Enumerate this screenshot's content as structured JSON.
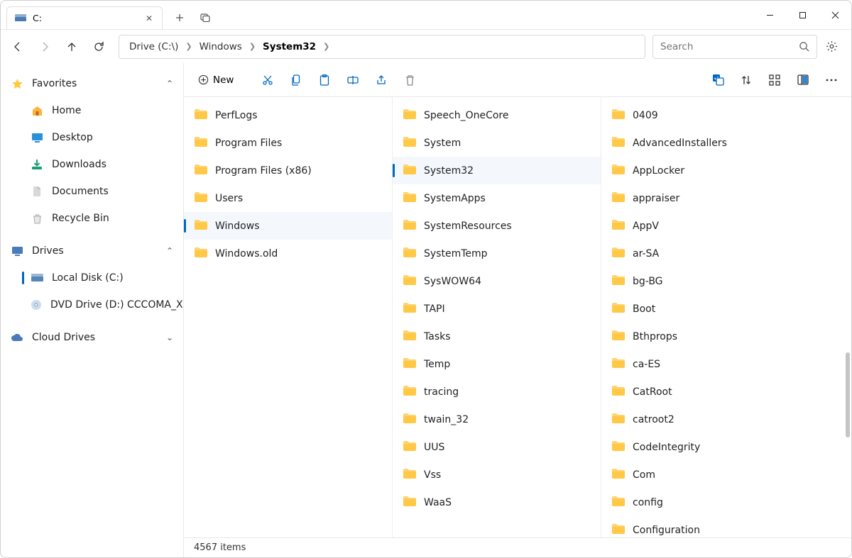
{
  "tab": {
    "title": "C:"
  },
  "breadcrumb": [
    "Drive (C:\\)",
    "Windows",
    "System32"
  ],
  "search": {
    "placeholder": "Search"
  },
  "toolbar": {
    "new_label": "New"
  },
  "sidebar": {
    "favorites": {
      "label": "Favorites",
      "items": [
        {
          "label": "Home",
          "icon": "home"
        },
        {
          "label": "Desktop",
          "icon": "desktop"
        },
        {
          "label": "Downloads",
          "icon": "downloads"
        },
        {
          "label": "Documents",
          "icon": "documents"
        },
        {
          "label": "Recycle Bin",
          "icon": "recycle"
        }
      ]
    },
    "drives": {
      "label": "Drives",
      "items": [
        {
          "label": "Local Disk (C:)",
          "icon": "disk",
          "selected": true
        },
        {
          "label": "DVD Drive (D:) CCCOMA_X",
          "icon": "dvd"
        }
      ]
    },
    "cloud": {
      "label": "Cloud Drives"
    }
  },
  "columns": [
    {
      "items": [
        {
          "name": "PerfLogs"
        },
        {
          "name": "Program Files"
        },
        {
          "name": "Program Files (x86)"
        },
        {
          "name": "Users"
        },
        {
          "name": "Windows",
          "selected": true
        },
        {
          "name": "Windows.old"
        }
      ]
    },
    {
      "items": [
        {
          "name": "Speech_OneCore"
        },
        {
          "name": "System"
        },
        {
          "name": "System32",
          "selected": true
        },
        {
          "name": "SystemApps"
        },
        {
          "name": "SystemResources"
        },
        {
          "name": "SystemTemp"
        },
        {
          "name": "SysWOW64"
        },
        {
          "name": "TAPI"
        },
        {
          "name": "Tasks"
        },
        {
          "name": "Temp"
        },
        {
          "name": "tracing"
        },
        {
          "name": "twain_32"
        },
        {
          "name": "UUS"
        },
        {
          "name": "Vss"
        },
        {
          "name": "WaaS"
        }
      ]
    },
    {
      "items": [
        {
          "name": "0409"
        },
        {
          "name": "AdvancedInstallers"
        },
        {
          "name": "AppLocker"
        },
        {
          "name": "appraiser"
        },
        {
          "name": "AppV"
        },
        {
          "name": "ar-SA"
        },
        {
          "name": "bg-BG"
        },
        {
          "name": "Boot"
        },
        {
          "name": "Bthprops"
        },
        {
          "name": "ca-ES"
        },
        {
          "name": "CatRoot"
        },
        {
          "name": "catroot2"
        },
        {
          "name": "CodeIntegrity"
        },
        {
          "name": "Com"
        },
        {
          "name": "config"
        },
        {
          "name": "Configuration"
        }
      ]
    }
  ],
  "status": {
    "items_text": "4567 items"
  }
}
